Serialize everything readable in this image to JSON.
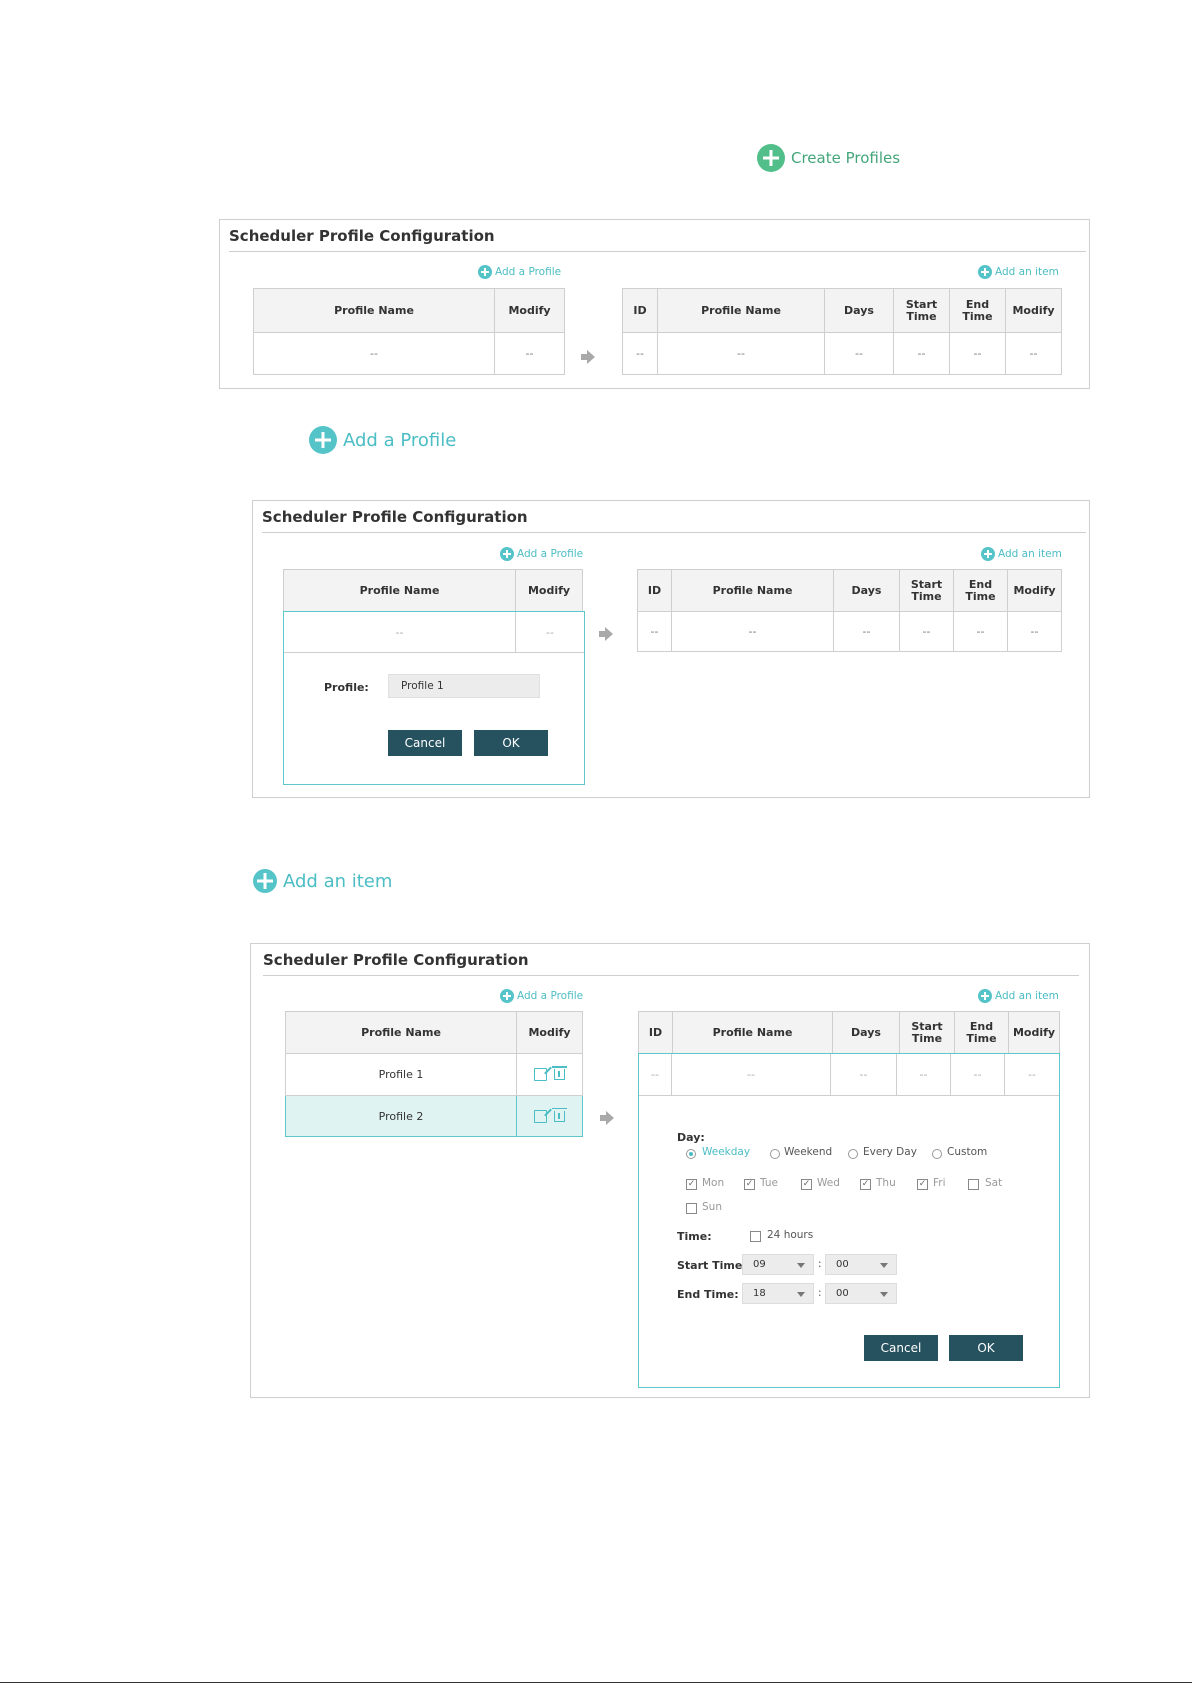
{
  "create_profiles": {
    "label": "Create Profiles"
  },
  "add_a_profile_big": {
    "label": "Add a Profile"
  },
  "add_an_item_big": {
    "label": "Add an item"
  },
  "panel1": {
    "title": "Scheduler Profile Configuration",
    "add_profile": "Add a Profile",
    "add_item": "Add an item",
    "left_headers": [
      "Profile Name",
      "Modify"
    ],
    "left_row": [
      "--",
      "--"
    ],
    "right_headers": [
      "ID",
      "Profile Name",
      "Days",
      "Start Time",
      "End Time",
      "Modify"
    ],
    "right_row": [
      "--",
      "--",
      "--",
      "--",
      "--",
      "--"
    ]
  },
  "panel2": {
    "title": "Scheduler Profile Configuration",
    "add_profile": "Add a Profile",
    "add_item": "Add an item",
    "left_headers": [
      "Profile Name",
      "Modify"
    ],
    "left_row": [
      "--",
      "--"
    ],
    "profile_label": "Profile:",
    "profile_value": "Profile 1",
    "cancel": "Cancel",
    "ok": "OK",
    "right_headers": [
      "ID",
      "Profile Name",
      "Days",
      "Start Time",
      "End Time",
      "Modify"
    ],
    "right_row": [
      "--",
      "--",
      "--",
      "--",
      "--",
      "--"
    ]
  },
  "panel3": {
    "title": "Scheduler Profile Configuration",
    "add_profile": "Add a Profile",
    "add_item": "Add an item",
    "left_headers": [
      "Profile Name",
      "Modify"
    ],
    "profiles": [
      "Profile 1",
      "Profile 2"
    ],
    "right_headers": [
      "ID",
      "Profile Name",
      "Days",
      "Start Time",
      "End Time",
      "Modify"
    ],
    "right_row": [
      "--",
      "--",
      "--",
      "--",
      "--",
      "--"
    ],
    "day_label": "Day:",
    "day_options": [
      "Weekday",
      "Weekend",
      "Every Day",
      "Custom"
    ],
    "selected_day": "Weekday",
    "weekdays": [
      "Mon",
      "Tue",
      "Wed",
      "Thu",
      "Fri",
      "Sat",
      "Sun"
    ],
    "time_label": "Time:",
    "hours24": "24 hours",
    "start_label": "Start Time:",
    "end_label": "End Time:",
    "start_hour": "09",
    "start_min": "00",
    "end_hour": "18",
    "end_min": "00",
    "colon": ":",
    "cancel": "Cancel",
    "ok": "OK"
  },
  "colors": {
    "accent": "#4bbdc4",
    "button": "#26515f",
    "create_green": "#43a67a"
  }
}
